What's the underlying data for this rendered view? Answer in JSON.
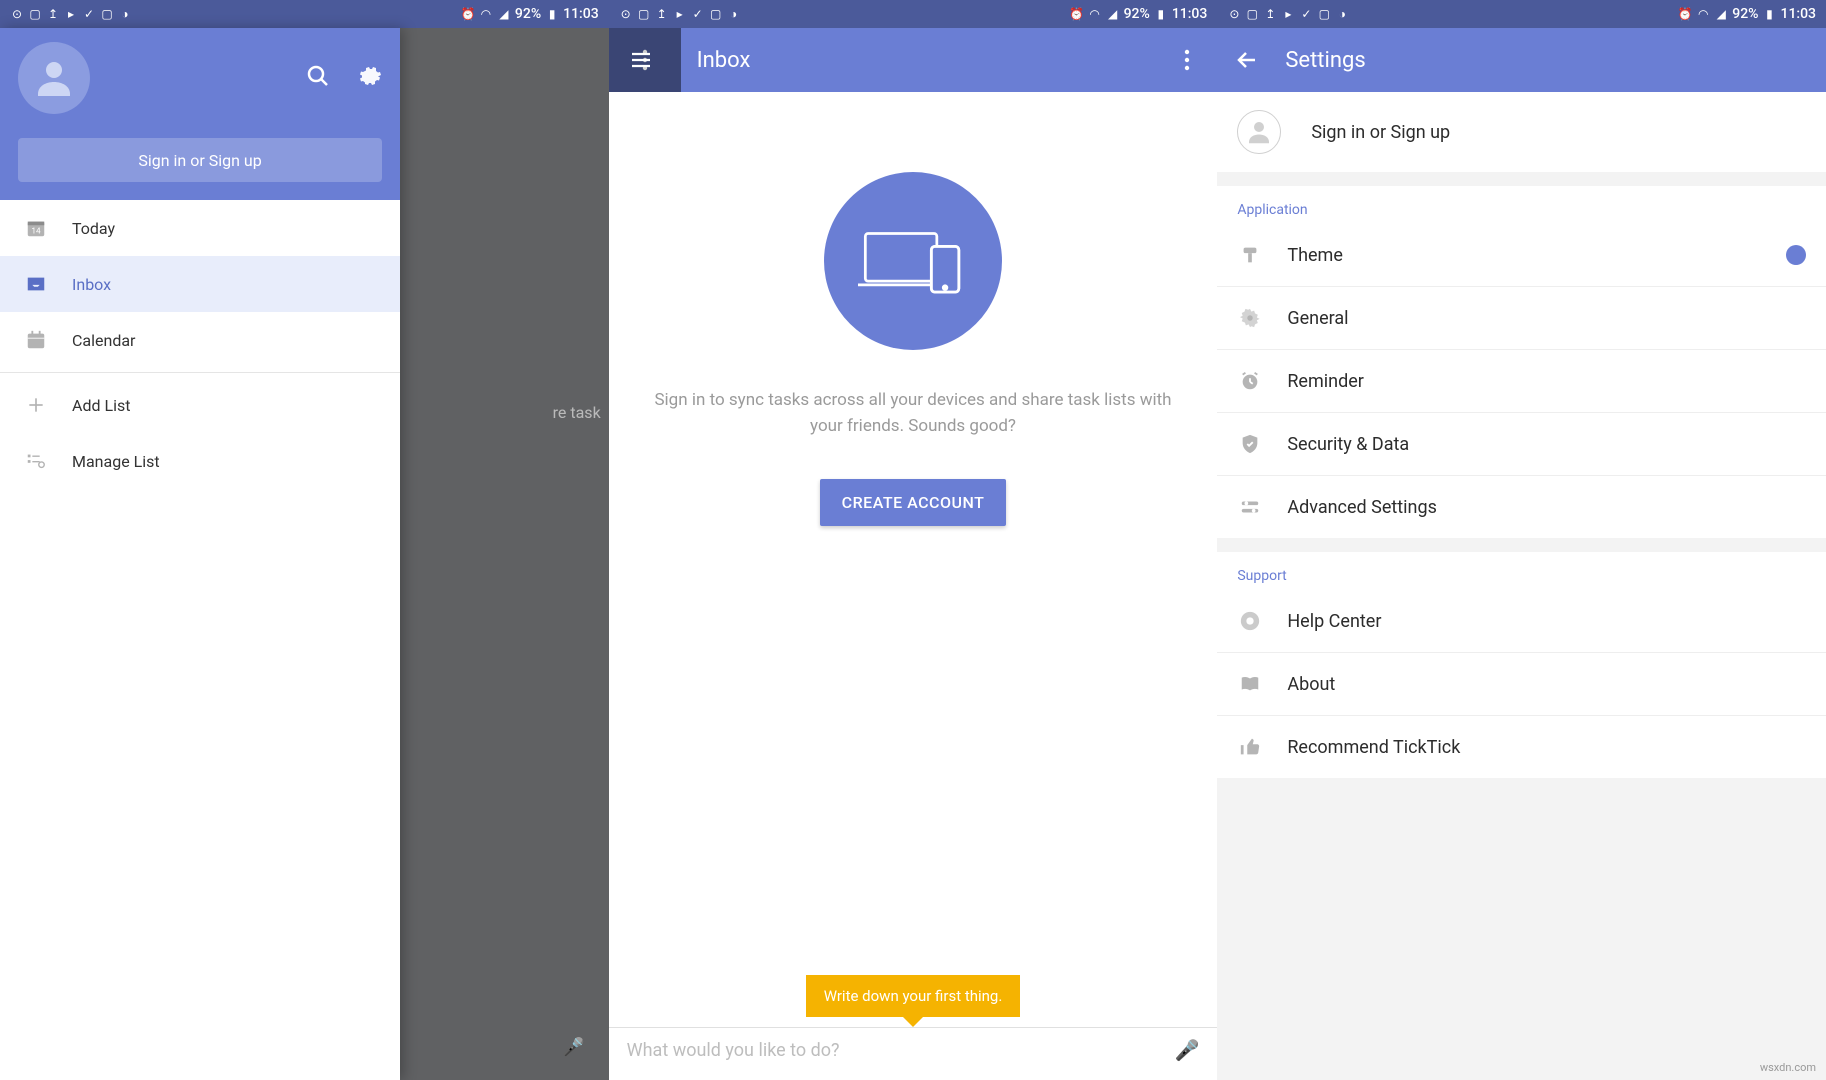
{
  "status": {
    "battery": "92%",
    "time": "11:03"
  },
  "panel1": {
    "signin": "Sign in or Sign up",
    "peek": "re task",
    "nav": {
      "today": "Today",
      "inbox": "Inbox",
      "calendar": "Calendar",
      "addlist": "Add List",
      "managelist": "Manage List",
      "cal_day": "14"
    }
  },
  "panel2": {
    "title": "Inbox",
    "hero": "Sign in to sync tasks across all your devices and share task lists with your friends. Sounds good?",
    "cta": "CREATE ACCOUNT",
    "tooltip": "Write down your first thing.",
    "placeholder": "What would you like to do?"
  },
  "panel3": {
    "title": "Settings",
    "signin": "Sign in or Sign up",
    "sections": {
      "application": "Application",
      "theme": "Theme",
      "general": "General",
      "reminder": "Reminder",
      "security": "Security & Data",
      "advanced": "Advanced Settings",
      "support": "Support",
      "help": "Help Center",
      "about": "About",
      "recommend": "Recommend TickTick"
    }
  },
  "watermark": "wsxdn.com"
}
